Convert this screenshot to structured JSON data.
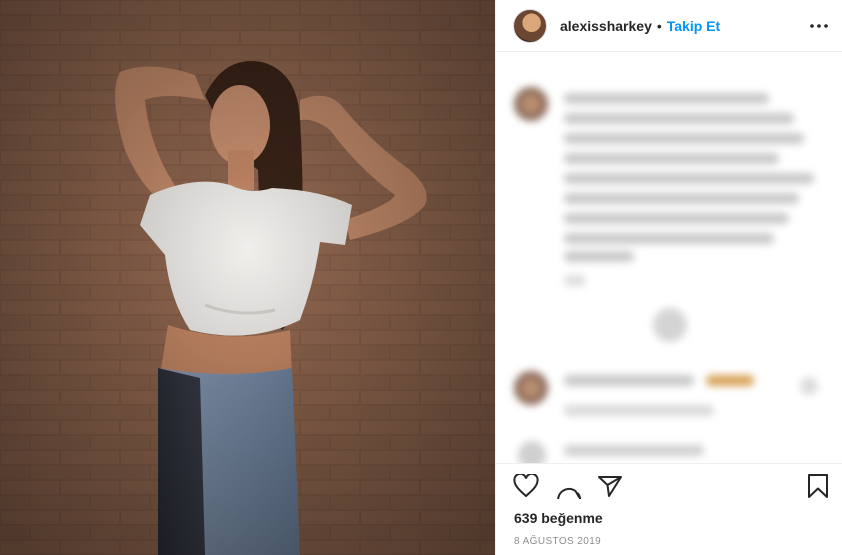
{
  "post": {
    "username": "alexissharkey",
    "separator": "•",
    "follow_label": "Takip Et",
    "likes_text": "639 beğenme",
    "date_text": "8 AĞUSTOS 2019"
  },
  "icons": {
    "more": "more-options-icon",
    "like": "heart-icon",
    "comment": "comment-icon",
    "share": "share-icon",
    "save": "bookmark-icon"
  },
  "colors": {
    "accent": "#0095f6",
    "text": "#262626",
    "muted": "#8e8e8e",
    "border": "#efefef"
  }
}
